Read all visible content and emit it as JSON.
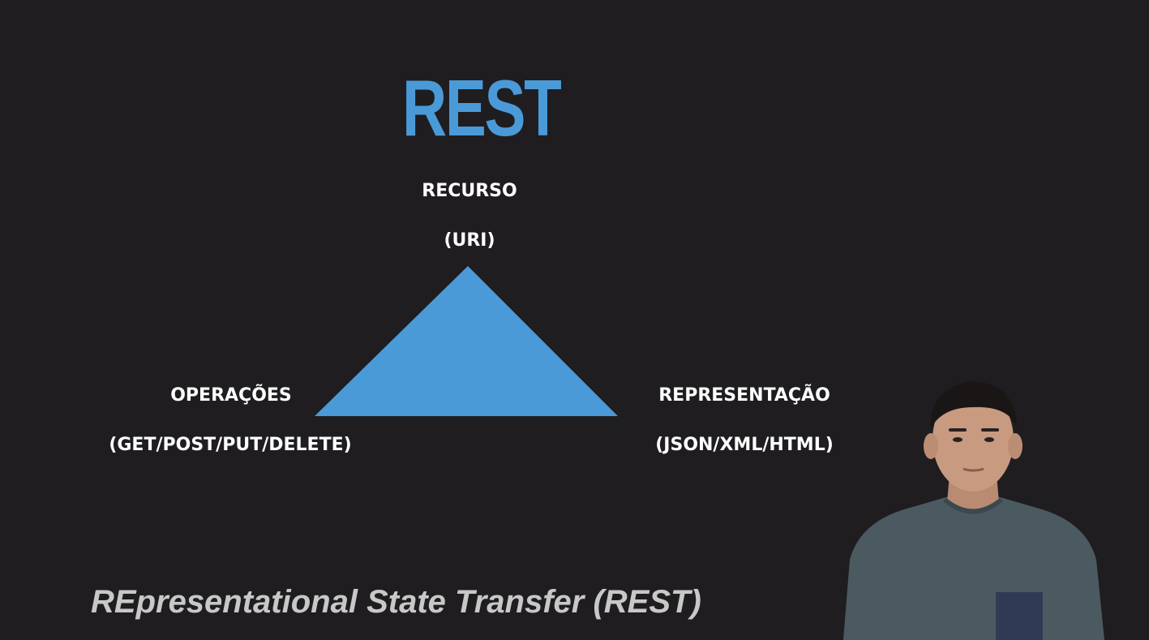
{
  "slide": {
    "title": "REST",
    "caption": "REpresentational State Transfer (REST)"
  },
  "diagram": {
    "shape": "triangle",
    "fill_color": "#4a9ad8",
    "top_vertex": {
      "label": "RECURSO",
      "sublabel": "(URI)"
    },
    "left_vertex": {
      "label": "OPERAÇÕES",
      "sublabel": "(GET/POST/PUT/DELETE)"
    },
    "right_vertex": {
      "label": "REPRESENTAÇÃO",
      "sublabel": "(JSON/XML/HTML)"
    }
  },
  "colors": {
    "background": "#1f1d20",
    "title": "#4a9ad8",
    "label_text": "#ffffff",
    "caption_text": "#c8c8c8"
  }
}
